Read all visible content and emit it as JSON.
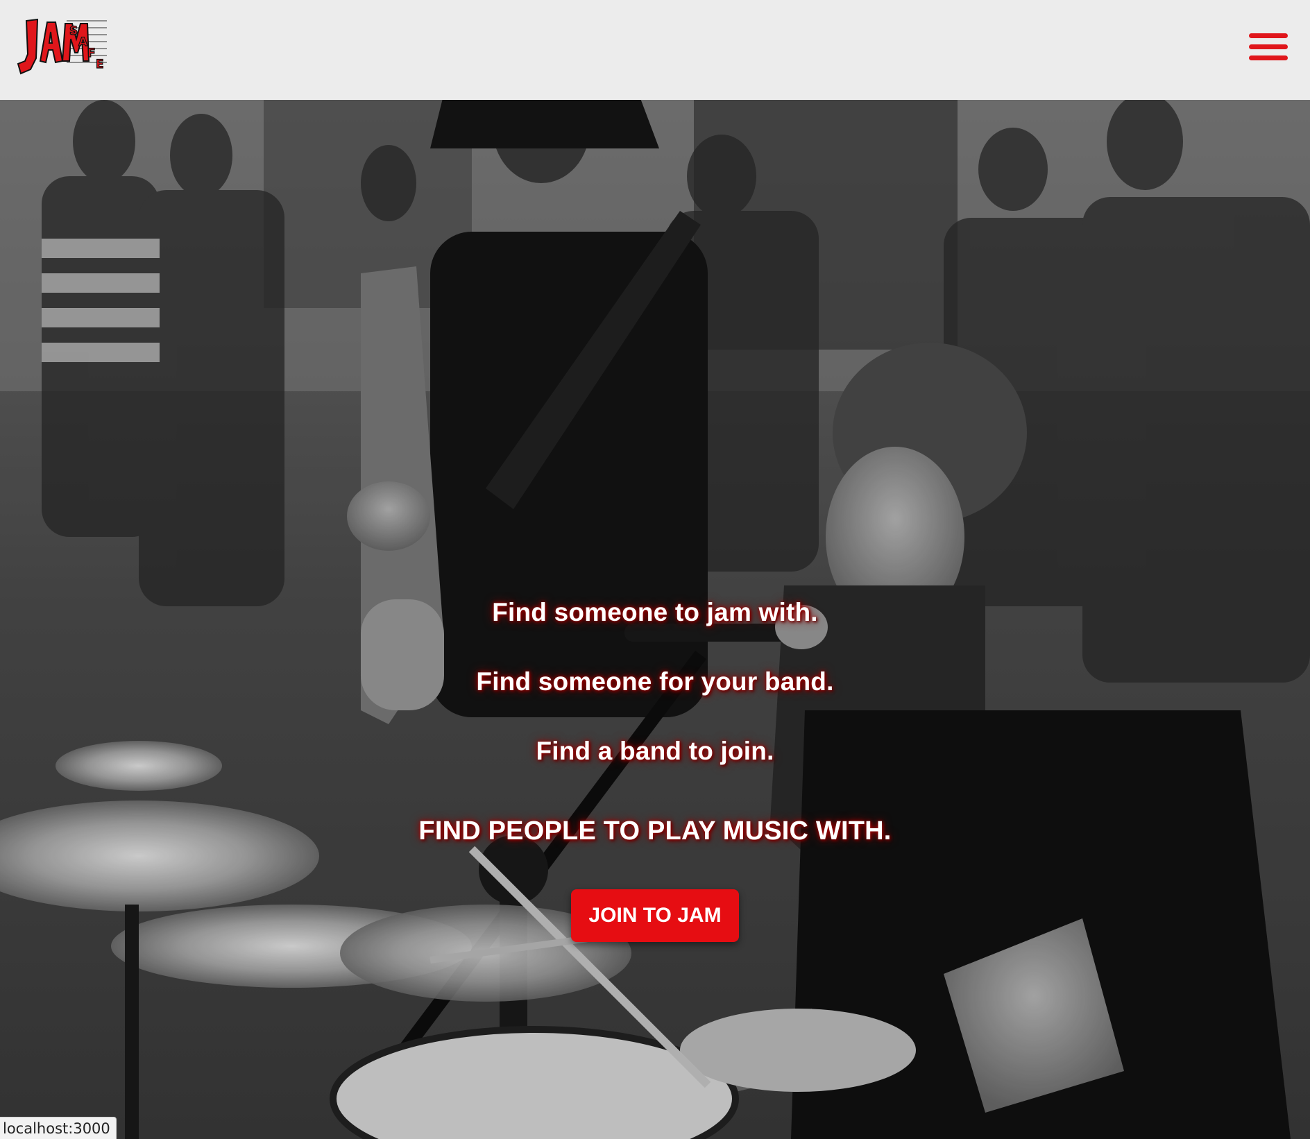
{
  "header": {
    "logo_text_main": "JAM",
    "logo_text_accent": "SAFE",
    "menu_icon": "hamburger-menu-icon",
    "accent_color": "#e0161b"
  },
  "hero": {
    "taglines": [
      "Find someone to jam with.",
      "Find someone for your band.",
      "Find a band to join.",
      "FIND PEOPLE TO PLAY MUSIC WITH."
    ],
    "cta_label": "JOIN TO JAM",
    "cta_color": "#e60d12",
    "background_image": "black-and-white photo of street musicians: drummer singing into microphone, bass guitarist, crowd"
  },
  "status_bar": {
    "url": "localhost:3000"
  }
}
